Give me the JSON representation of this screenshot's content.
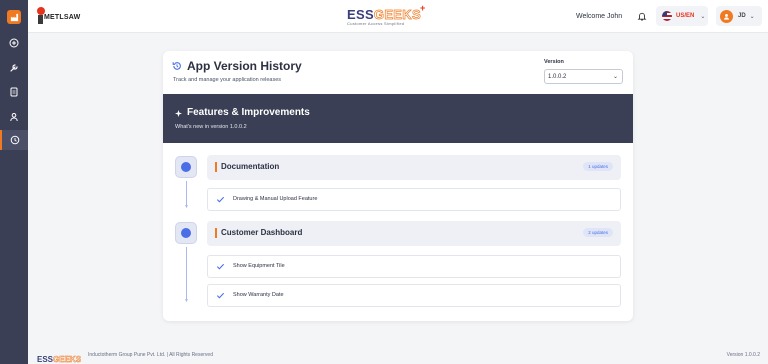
{
  "header": {
    "brand_name": "METLSAW",
    "logo": {
      "part1": "ESS",
      "part2": "GEEKS",
      "plus": "+",
      "tagline": "Customer Access Simplified"
    },
    "welcome": "Welcome John",
    "language": "US/EN",
    "user_initials": "JD"
  },
  "sidebar": {
    "items": [
      {
        "name": "dashboard",
        "icon": "plus-circle-icon"
      },
      {
        "name": "tools",
        "icon": "wrench-icon"
      },
      {
        "name": "documents",
        "icon": "document-icon"
      },
      {
        "name": "profile",
        "icon": "user-icon"
      },
      {
        "name": "version-history",
        "icon": "clock-icon",
        "active": true
      }
    ]
  },
  "page": {
    "title": "App Version History",
    "subtitle": "Track and manage your application releases",
    "version_label": "Version",
    "version_value": "1.0.0.2"
  },
  "banner": {
    "title": "Features & Improvements",
    "subtitle": "What's new in version 1.0.0.2"
  },
  "sections": [
    {
      "title": "Documentation",
      "badge": "1 updates",
      "items": [
        "Drawing & Manual Upload Feature"
      ]
    },
    {
      "title": "Customer Dashboard",
      "badge": "2 updates",
      "items": [
        "Show Equipment Tile",
        "Show Warranty Date"
      ]
    }
  ],
  "footer": {
    "logo_part1": "ESS",
    "logo_part2": "GEEKS",
    "copyright": "Inductotherm Group Pune Pvt. Ltd. | All Rights Reserved",
    "version": "Version 1.0.0.2"
  },
  "colors": {
    "accent": "#f07a22",
    "sidebar": "#3a3f55",
    "primary_blue": "#4a6ee8"
  }
}
